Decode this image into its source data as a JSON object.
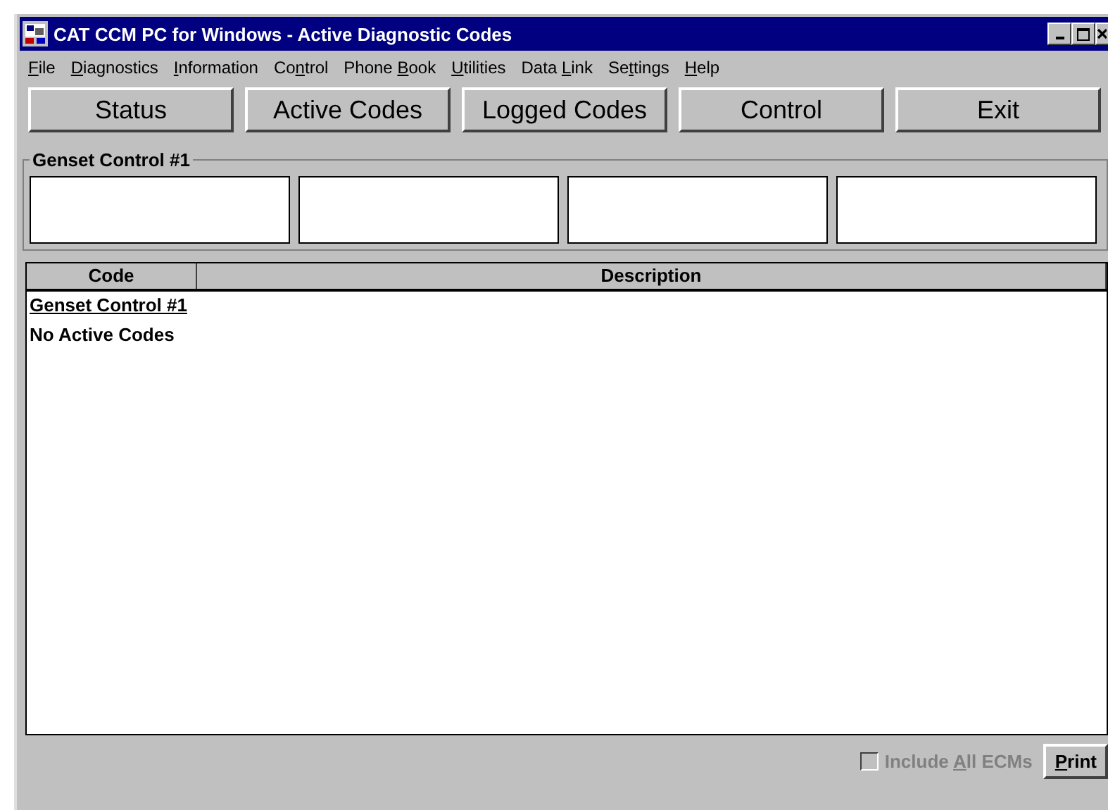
{
  "window": {
    "title": "CAT CCM PC for Windows - Active Diagnostic Codes"
  },
  "menu": [
    {
      "parts": [
        {
          "text": "F",
          "underlined": true
        },
        {
          "text": "ile",
          "underlined": false
        }
      ]
    },
    {
      "parts": [
        {
          "text": "D",
          "underlined": true
        },
        {
          "text": "iagnostics",
          "underlined": false
        }
      ]
    },
    {
      "parts": [
        {
          "text": "I",
          "underlined": true
        },
        {
          "text": "nformation",
          "underlined": false
        }
      ]
    },
    {
      "parts": [
        {
          "text": "Co",
          "underlined": false
        },
        {
          "text": "n",
          "underlined": true
        },
        {
          "text": "trol",
          "underlined": false
        }
      ]
    },
    {
      "parts": [
        {
          "text": "Phone ",
          "underlined": false
        },
        {
          "text": "B",
          "underlined": true
        },
        {
          "text": "ook",
          "underlined": false
        }
      ]
    },
    {
      "parts": [
        {
          "text": "U",
          "underlined": true
        },
        {
          "text": "tilities",
          "underlined": false
        }
      ]
    },
    {
      "parts": [
        {
          "text": "Data ",
          "underlined": false
        },
        {
          "text": "L",
          "underlined": true
        },
        {
          "text": "ink",
          "underlined": false
        }
      ]
    },
    {
      "parts": [
        {
          "text": "Se",
          "underlined": false
        },
        {
          "text": "t",
          "underlined": true
        },
        {
          "text": "tings",
          "underlined": false
        }
      ]
    },
    {
      "parts": [
        {
          "text": "H",
          "underlined": true
        },
        {
          "text": "elp",
          "underlined": false
        }
      ]
    }
  ],
  "toolbar": [
    {
      "label": "Status"
    },
    {
      "label": "Active Codes"
    },
    {
      "label": "Logged Codes"
    },
    {
      "label": "Control"
    },
    {
      "label": "Exit"
    }
  ],
  "group": {
    "title": "Genset Control #1",
    "fields": [
      {
        "kind": "empty"
      },
      {
        "kind": "empty"
      },
      {
        "kind": "empty"
      },
      {
        "kind": "empty"
      }
    ]
  },
  "table": {
    "columns": [
      "Code",
      "Description"
    ],
    "sections": [
      {
        "heading": "Genset Control #1",
        "message": "No Active Codes"
      }
    ]
  },
  "footer": {
    "checkbox": {
      "parts": [
        {
          "text": "Include ",
          "underlined": false
        },
        {
          "text": "A",
          "underlined": true
        },
        {
          "text": "ll ECMs",
          "underlined": false
        }
      ],
      "checked": false,
      "disabled": true
    },
    "print": {
      "parts": [
        {
          "text": "P",
          "underlined": true
        },
        {
          "text": "rint",
          "underlined": false
        }
      ]
    }
  }
}
